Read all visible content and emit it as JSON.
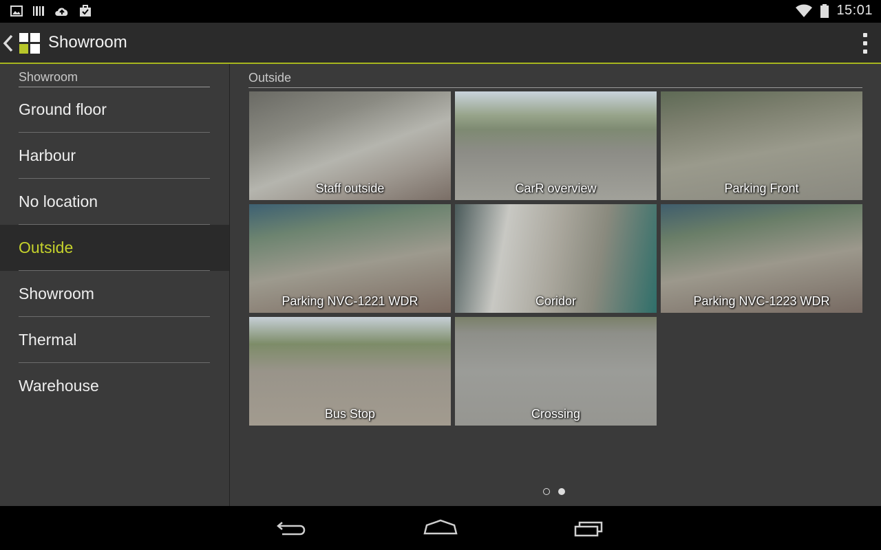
{
  "status_bar": {
    "icons": [
      "image-icon",
      "barcode-icon",
      "cloud-upload-icon",
      "briefcase-check-icon"
    ],
    "right_icons": [
      "wifi-icon",
      "battery-icon"
    ],
    "time": "15:01"
  },
  "action_bar": {
    "title": "Showroom",
    "accent_color": "#a7b61e"
  },
  "sidebar": {
    "header": "Showroom",
    "items": [
      {
        "label": "Ground floor",
        "active": false
      },
      {
        "label": "Harbour",
        "active": false
      },
      {
        "label": "No location",
        "active": false
      },
      {
        "label": "Outside",
        "active": true
      },
      {
        "label": "Showroom",
        "active": false
      },
      {
        "label": "Thermal",
        "active": false
      },
      {
        "label": "Warehouse",
        "active": false
      }
    ],
    "active_color": "#c5d22c"
  },
  "main": {
    "header": "Outside",
    "cameras": [
      {
        "name": "Staff outside"
      },
      {
        "name": "CarR overview"
      },
      {
        "name": "Parking Front"
      },
      {
        "name": "Parking NVC-1221 WDR"
      },
      {
        "name": "Coridor"
      },
      {
        "name": "Parking NVC-1223 WDR"
      },
      {
        "name": "Bus Stop"
      },
      {
        "name": "Crossing"
      }
    ],
    "pager": {
      "pages": 2,
      "current": 2
    }
  },
  "nav_bar": {
    "buttons": [
      "back-icon",
      "home-icon",
      "recent-apps-icon"
    ]
  }
}
